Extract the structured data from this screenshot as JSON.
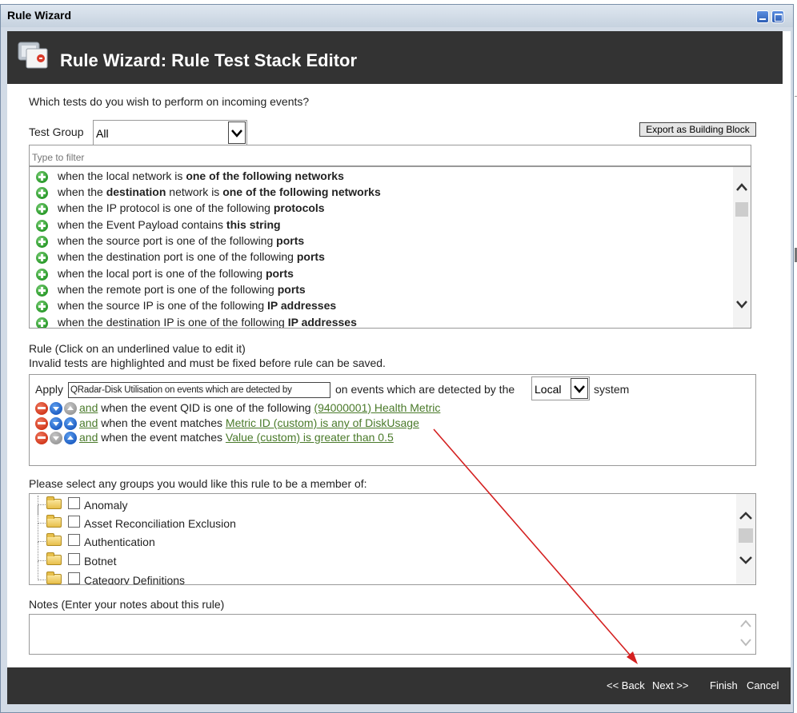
{
  "window": {
    "title": "Rule Wizard"
  },
  "header": {
    "title": "Rule Wizard: Rule Test Stack Editor",
    "icon": "rule-wizard-icon"
  },
  "question": "Which tests do you wish to perform on incoming events?",
  "test_group": {
    "label": "Test Group",
    "value": "All"
  },
  "export_button": "Export as Building Block",
  "filter": {
    "placeholder": "Type to filter"
  },
  "tests": [
    {
      "pre": "when the local network is ",
      "bold": "one of the following networks",
      "post": ""
    },
    {
      "pre": "when the ",
      "bold": "destination",
      "post": " network is ",
      "bold2": "one of the following networks"
    },
    {
      "pre": "when the IP protocol is one of the following ",
      "bold": "protocols",
      "post": ""
    },
    {
      "pre": "when the Event Payload contains ",
      "bold": "this string",
      "post": ""
    },
    {
      "pre": "when the source port is one of the following ",
      "bold": "ports",
      "post": ""
    },
    {
      "pre": "when the destination port is one of the following ",
      "bold": "ports",
      "post": ""
    },
    {
      "pre": "when the local port is one of the following ",
      "bold": "ports",
      "post": ""
    },
    {
      "pre": "when the remote port is one of the following ",
      "bold": "ports",
      "post": ""
    },
    {
      "pre": "when the source IP is one of the following ",
      "bold": "IP addresses",
      "post": ""
    },
    {
      "pre": "when the destination IP is one of the following ",
      "bold": "IP addresses",
      "post": ""
    }
  ],
  "rule": {
    "heading": "Rule (Click on an underlined value to edit it)",
    "note": "Invalid tests are highlighted and must be fixed before rule can be saved.",
    "apply_label": "Apply",
    "apply_value": "QRadar-Disk Utilisation on events which are detected by",
    "detected_text": "on events which are detected by the",
    "system_value": "Local",
    "system_label": "system",
    "lines": [
      {
        "and": " and",
        "text": " when the event QID is one of the following ",
        "link": "(94000001) Health Metric"
      },
      {
        "and": " and",
        "text": " when the event matches ",
        "link": "Metric ID (custom) is any of DiskUsage"
      },
      {
        "and": " and",
        "text": " when the event matches ",
        "link": "Value (custom) is greater than 0.5"
      }
    ]
  },
  "groups": {
    "heading": "Please select any groups you would like this rule to be a member of:",
    "items": [
      "Anomaly",
      "Asset Reconciliation Exclusion",
      "Authentication",
      "Botnet",
      "Category Definitions"
    ]
  },
  "notes": {
    "heading": "Notes (Enter your notes about this rule)",
    "value": ""
  },
  "footer": {
    "back": "<< Back",
    "next": "Next >>",
    "finish": "Finish",
    "cancel": "Cancel"
  },
  "colors": {
    "header_bg": "#333333",
    "link": "#4a7a2a",
    "annotation_arrow": "#d42020"
  }
}
